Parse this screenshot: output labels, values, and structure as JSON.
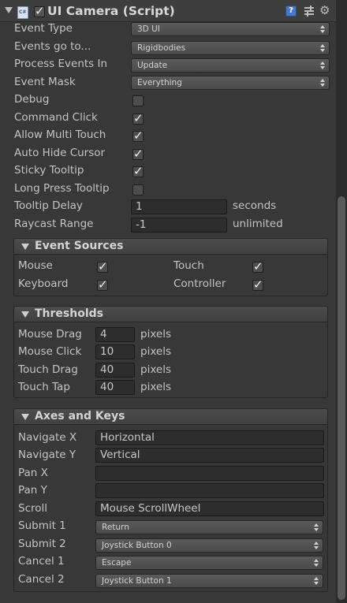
{
  "header": {
    "title": "UI Camera (Script)",
    "enabled": true,
    "script_icon": "csharp-script-icon",
    "help_icon": "help-icon",
    "preset_icon": "preset-icon",
    "gear_icon": "gear-icon"
  },
  "fields": {
    "event_type": {
      "label": "Event Type",
      "value": "3D UI"
    },
    "events_go_to": {
      "label": "Events go to...",
      "value": "Rigidbodies"
    },
    "process_events_in": {
      "label": "Process Events In",
      "value": "Update"
    },
    "event_mask": {
      "label": "Event Mask",
      "value": "Everything"
    },
    "debug": {
      "label": "Debug",
      "checked": false
    },
    "command_click": {
      "label": "Command Click",
      "checked": true
    },
    "allow_multi_touch": {
      "label": "Allow Multi Touch",
      "checked": true
    },
    "auto_hide_cursor": {
      "label": "Auto Hide Cursor",
      "checked": true
    },
    "sticky_tooltip": {
      "label": "Sticky Tooltip",
      "checked": true
    },
    "long_press_tooltip": {
      "label": "Long Press Tooltip",
      "checked": false
    },
    "tooltip_delay": {
      "label": "Tooltip Delay",
      "value": "1",
      "unit": "seconds"
    },
    "raycast_range": {
      "label": "Raycast Range",
      "value": "-1",
      "unit": "unlimited"
    }
  },
  "event_sources": {
    "title": "Event Sources",
    "mouse": {
      "label": "Mouse",
      "checked": true
    },
    "touch": {
      "label": "Touch",
      "checked": true
    },
    "keyboard": {
      "label": "Keyboard",
      "checked": true
    },
    "controller": {
      "label": "Controller",
      "checked": true
    }
  },
  "thresholds": {
    "title": "Thresholds",
    "mouse_drag": {
      "label": "Mouse Drag",
      "value": "4",
      "unit": "pixels"
    },
    "mouse_click": {
      "label": "Mouse Click",
      "value": "10",
      "unit": "pixels"
    },
    "touch_drag": {
      "label": "Touch Drag",
      "value": "40",
      "unit": "pixels"
    },
    "touch_tap": {
      "label": "Touch Tap",
      "value": "40",
      "unit": "pixels"
    }
  },
  "axes": {
    "title": "Axes and Keys",
    "navigate_x": {
      "label": "Navigate X",
      "value": "Horizontal"
    },
    "navigate_y": {
      "label": "Navigate Y",
      "value": "Vertical"
    },
    "pan_x": {
      "label": "Pan X",
      "value": ""
    },
    "pan_y": {
      "label": "Pan Y",
      "value": ""
    },
    "scroll": {
      "label": "Scroll",
      "value": "Mouse ScrollWheel"
    },
    "submit_1": {
      "label": "Submit 1",
      "value": "Return"
    },
    "submit_2": {
      "label": "Submit 2",
      "value": "Joystick Button 0"
    },
    "cancel_1": {
      "label": "Cancel 1",
      "value": "Escape"
    },
    "cancel_2": {
      "label": "Cancel 2",
      "value": "Joystick Button 1"
    }
  },
  "colors": {
    "background": "#383838",
    "text": "#c4c4c4",
    "field_bg": "#2d2d2d",
    "dropdown_bg": "#4e4e4e",
    "help_icon": "#4a78c2"
  }
}
